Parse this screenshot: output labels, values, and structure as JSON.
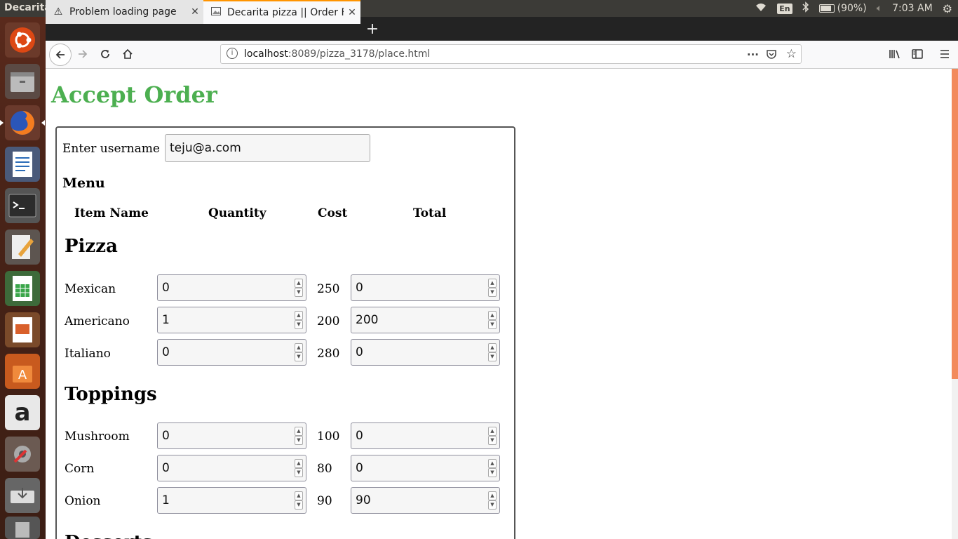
{
  "system": {
    "window_title": "Decarita pizza || Order Food - Mozilla Firefox",
    "keyboard": "En",
    "battery": "(90%)",
    "time": "7:03 AM"
  },
  "browser": {
    "tabs": [
      {
        "label": "Problem loading page",
        "icon": "warning-icon"
      },
      {
        "label": "Decarita pizza || Order Fo",
        "icon": "image-icon"
      }
    ],
    "url_host": "localhost",
    "url_rest": ":8089/pizza_3178/place.html"
  },
  "page": {
    "title": "Accept Order",
    "username_label": "Enter username :",
    "username_value": "teju@a.com",
    "menu_label": "Menu",
    "columns": [
      "Item Name",
      "Quantity",
      "Cost",
      "Total"
    ],
    "sections": [
      {
        "name": "Pizza",
        "items": [
          {
            "name": "Mexican",
            "qty": "0",
            "cost": "250",
            "total": "0"
          },
          {
            "name": "Americano",
            "qty": "1",
            "cost": "200",
            "total": "200"
          },
          {
            "name": "Italiano",
            "qty": "0",
            "cost": "280",
            "total": "0"
          }
        ]
      },
      {
        "name": "Toppings",
        "items": [
          {
            "name": "Mushroom",
            "qty": "0",
            "cost": "100",
            "total": "0"
          },
          {
            "name": "Corn",
            "qty": "0",
            "cost": "80",
            "total": "0"
          },
          {
            "name": "Onion",
            "qty": "1",
            "cost": "90",
            "total": "90"
          }
        ]
      }
    ],
    "next_section_partial": "Desserts"
  }
}
